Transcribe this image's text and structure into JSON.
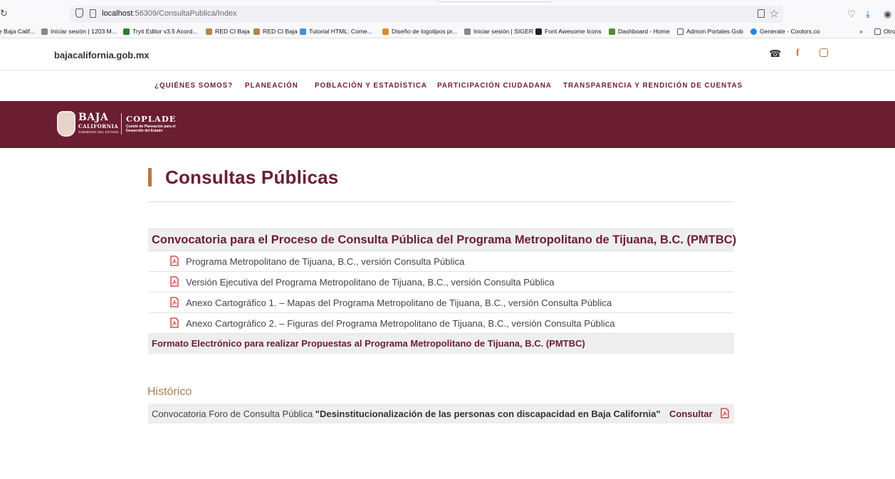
{
  "browser": {
    "url_host": "localhost",
    "url_path": ":56309/ConsultaPublica/Index",
    "bookmarks": [
      {
        "label": "e Baja Calif...",
        "icon": "site-icon"
      },
      {
        "label": "Iniciar sesión | 1203 M...",
        "icon": "site-icon"
      },
      {
        "label": "Tryit Editor v3.5 Acord...",
        "icon": "w3-icon"
      },
      {
        "label": "RED CI Baja",
        "icon": "shield-icon"
      },
      {
        "label": "RED CI Baja",
        "icon": "shield-icon"
      },
      {
        "label": "Tutorial HTML: Come...",
        "icon": "site-icon"
      },
      {
        "label": "Diseño de logotipos pr...",
        "icon": "site-icon"
      },
      {
        "label": "Iniciar sesión | SIGER",
        "icon": "site-icon"
      },
      {
        "label": "Font Awesome Icons",
        "icon": "flag-icon"
      },
      {
        "label": "Dashboard - Home",
        "icon": "site-icon"
      },
      {
        "label": "Admon Portales Gob",
        "icon": "folder-icon"
      },
      {
        "label": "Generate - Coolors.co",
        "icon": "site-icon"
      },
      {
        "label": "Otro",
        "icon": "folder-icon"
      }
    ]
  },
  "header": {
    "domain": "bajacalifornia.gob.mx",
    "icons": [
      "phone-icon",
      "facebook-icon",
      "instagram-icon"
    ]
  },
  "nav": {
    "items": [
      "¿QUIÉNES SOMOS?",
      "PLANEACIÓN",
      "POBLACIÓN Y ESTADÍSTICA",
      "PARTICIPACIÓN CIUDADANA",
      "TRANSPARENCIA Y RENDICIÓN DE CUENTAS"
    ]
  },
  "banner": {
    "logo_baja": "BAJA",
    "logo_california": "CALIFORNIA",
    "logo_gob": "GOBIERNO DEL ESTADO",
    "logo_coplade": "COPLADE",
    "logo_sub": "Comité de Planeación para el Desarrollo del Estado"
  },
  "main": {
    "title": "Consultas Públicas",
    "section_title": "Convocatoria para el Proceso de Consulta Pública del Programa Metropolitano de Tijuana, B.C. (PMTBC)",
    "documents": [
      "Programa Metropolitano de Tijuana, B.C., versión Consulta Pública",
      "Versión Ejecutiva del Programa Metropolitano de Tijuana, B.C., versión Consulta Pública",
      "Anexo Cartográfico 1. – Mapas del Programa Metropolitano de Tijuana, B.C., versión Consulta Pública",
      "Anexo Cartográfico 2. – Figuras del Programa Metropolitano de Tijuana, B.C., versión Consulta Pública"
    ],
    "form_link": "Formato Electrónico para realizar Propuestas al Programa Metropolitano de Tijuana, B.C. (PMTBC)"
  },
  "historico": {
    "title": "Histórico",
    "item_prefix": "Convocatoria Foro de Consulta Pública ",
    "item_bold": "\"Desinstitucionalización de las personas con discapacidad en Baja California\"",
    "action": "Consultar"
  },
  "colors": {
    "brand": "#6b1d32",
    "accent": "#b17b4a",
    "pdf_red": "#d32f2f"
  }
}
